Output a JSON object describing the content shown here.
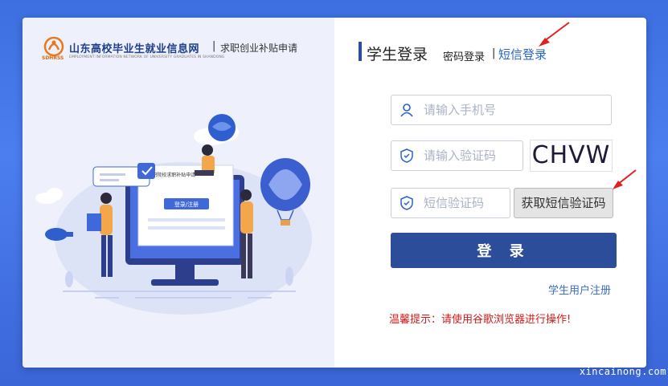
{
  "brand": {
    "title": "山东高校毕业生就业信息网",
    "separator": "|",
    "subtitle": "求职创业补贴申请",
    "abbr": "SDHRSS",
    "english": "EMPLOYMENT INFORMATION NETWORK OF UNIVERSITY GRADUATES IN SHANDONG"
  },
  "illustration": {
    "screen_caption": "◎中职院校求职补贴申请",
    "screen_button": "登录/注册"
  },
  "login": {
    "title": "学生登录",
    "password_tab": "密码登录",
    "divider": "|",
    "sms_tab": "短信登录",
    "phone_placeholder": "请输入手机号",
    "code_placeholder": "请输入验证码",
    "captcha_text": "CHVW",
    "sms_placeholder": "短信验证码",
    "sms_button": "获取短信验证码",
    "submit": "登 录",
    "register": "学生用户注册",
    "tip": "温馨提示：请使用谷歌浏览器进行操作!"
  },
  "watermark": "xincainong.com",
  "colors": {
    "background": "#4073e4",
    "accent": "#2c4e9a",
    "link": "#2a63c6",
    "warning": "#d61a1a",
    "arrow": "#e02020"
  },
  "icons": {
    "phone_field": "user-icon",
    "code_field": "shield-check-icon",
    "sms_field": "shield-check-icon"
  }
}
